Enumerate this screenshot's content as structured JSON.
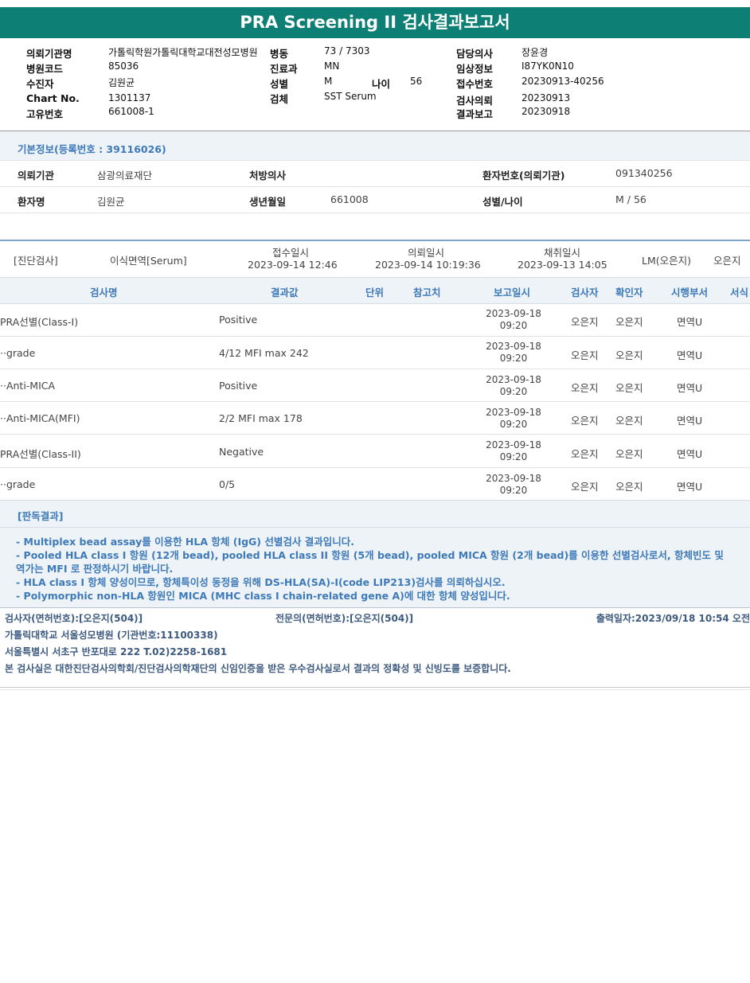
{
  "title": "PRA Screening II 검사결과보고서",
  "header": {
    "col1": [
      {
        "label": "의뢰기관명",
        "value": "가톨릭학원가톨릭대학교대전성모병원"
      },
      {
        "label": "병원코드",
        "value": "85036"
      },
      {
        "label": "수진자",
        "value": "김원균"
      },
      {
        "label": "Chart No.",
        "value": "1301137"
      },
      {
        "label": "고유번호",
        "value": "661008-1"
      }
    ],
    "ward_label": "병동",
    "ward_value": "73 / 7303",
    "dept_label": "진료과",
    "dept_value": "MN",
    "sex_label": "성별",
    "sex_value": "M",
    "age_label": "나이",
    "age_value": "56",
    "specimen_label": "검체",
    "specimen_value": "SST Serum",
    "col3": [
      {
        "label": "담당의사",
        "value": "장윤경"
      },
      {
        "label": "임상정보",
        "value": "I87YK0N10"
      },
      {
        "label": "접수번호",
        "value": "20230913-40256"
      },
      {
        "label": "검사의뢰",
        "value": "20230913"
      },
      {
        "label": "결과보고",
        "value": "20230918"
      }
    ]
  },
  "basic": {
    "title": "기본정보(등록번호 : 39116026)",
    "institution_label": "의뢰기관",
    "institution_value": "삼광의료재단",
    "doctor_label": "처방의사",
    "patient_no_label": "환자번호(의뢰기관)",
    "patient_no_value": "091340256",
    "name_label": "환자명",
    "name_value": "김원균",
    "birth_label": "생년월일",
    "birth_value": "661008",
    "sexage_label": "성별/나이",
    "sexage_value": "M / 56"
  },
  "exam": {
    "category": "[진단검사]",
    "name": "이식면역[Serum]",
    "received_label": "접수일시",
    "received_value": "2023-09-14 12:46",
    "requested_label": "의뢰일시",
    "requested_value": "2023-09-14 10:19:36",
    "collected_label": "채취일시",
    "collected_value": "2023-09-13 14:05",
    "lm": "LM(오은지)",
    "tech": "오은지"
  },
  "table": {
    "headers": [
      "검사명",
      "결과값",
      "단위",
      "참고치",
      "보고일시",
      "검사자",
      "확인자",
      "시행부서",
      "서식"
    ],
    "rows": [
      {
        "name": "PRA선별(Class-I)",
        "result": "Positive",
        "date": "2023-09-18",
        "time": "09:20",
        "tester": "오은지",
        "checker": "오은지",
        "dept": "면역U"
      },
      {
        "name": "··grade",
        "result": "4/12 MFI max 242",
        "date": "2023-09-18",
        "time": "09:20",
        "tester": "오은지",
        "checker": "오은지",
        "dept": "면역U"
      },
      {
        "name": "··Anti-MICA",
        "result": "Positive",
        "date": "2023-09-18",
        "time": "09:20",
        "tester": "오은지",
        "checker": "오은지",
        "dept": "면역U"
      },
      {
        "name": "··Anti-MICA(MFI)",
        "result": "2/2 MFI max 178",
        "date": "2023-09-18",
        "time": "09:20",
        "tester": "오은지",
        "checker": "오은지",
        "dept": "면역U"
      },
      {
        "name": "PRA선별(Class-II)",
        "result": "Negative",
        "date": "2023-09-18",
        "time": "09:20",
        "tester": "오은지",
        "checker": "오은지",
        "dept": "면역U"
      },
      {
        "name": "··grade",
        "result": "0/5",
        "date": "2023-09-18",
        "time": "09:20",
        "tester": "오은지",
        "checker": "오은지",
        "dept": "면역U"
      }
    ]
  },
  "interpretation": {
    "title": "[판독결과]",
    "lines": [
      "- Multiplex bead assay를 이용한 HLA 항체 (IgG) 선별검사 결과입니다.",
      "- Pooled HLA class I 항원 (12개 bead), pooled HLA class II 항원 (5개 bead), pooled MICA 항원 (2개 bead)를 이용한 선별검사로서, 항체빈도 및 역가는 MFI 로 판정하시기 바랍니다.",
      "- HLA class I 항체 양성이므로, 항체특이성 동정을 위해 DS-HLA(SA)-I(code LIP213)검사를 의뢰하십시오.",
      "- Polymorphic non-HLA 항원인 MICA (MHC class I chain-related gene A)에 대한 항체 양성입니다."
    ]
  },
  "footer": {
    "tester": "검사자(면허번호):[오은지(504)]",
    "specialist": "전문의(면허번호):[오은지(504)]",
    "printed": "출력일자:2023/09/18 10:54 오전",
    "hospital": "가톨릭대학교 서울성모병원 (기관번호:11100338)",
    "address": "서울특별시 서초구 반포대로 222 T.02)2258-1681",
    "certification": "본 검사실은 대한진단검사의학회/진단검사의학재단의 신임인증을 받은 우수검사실로서 결과의 정확성 및 신빙도를 보증합니다."
  },
  "colors": {
    "title_bg": "#0d7f74",
    "accent_text": "#3e7ab8",
    "band_bg": "#eef3f8"
  }
}
